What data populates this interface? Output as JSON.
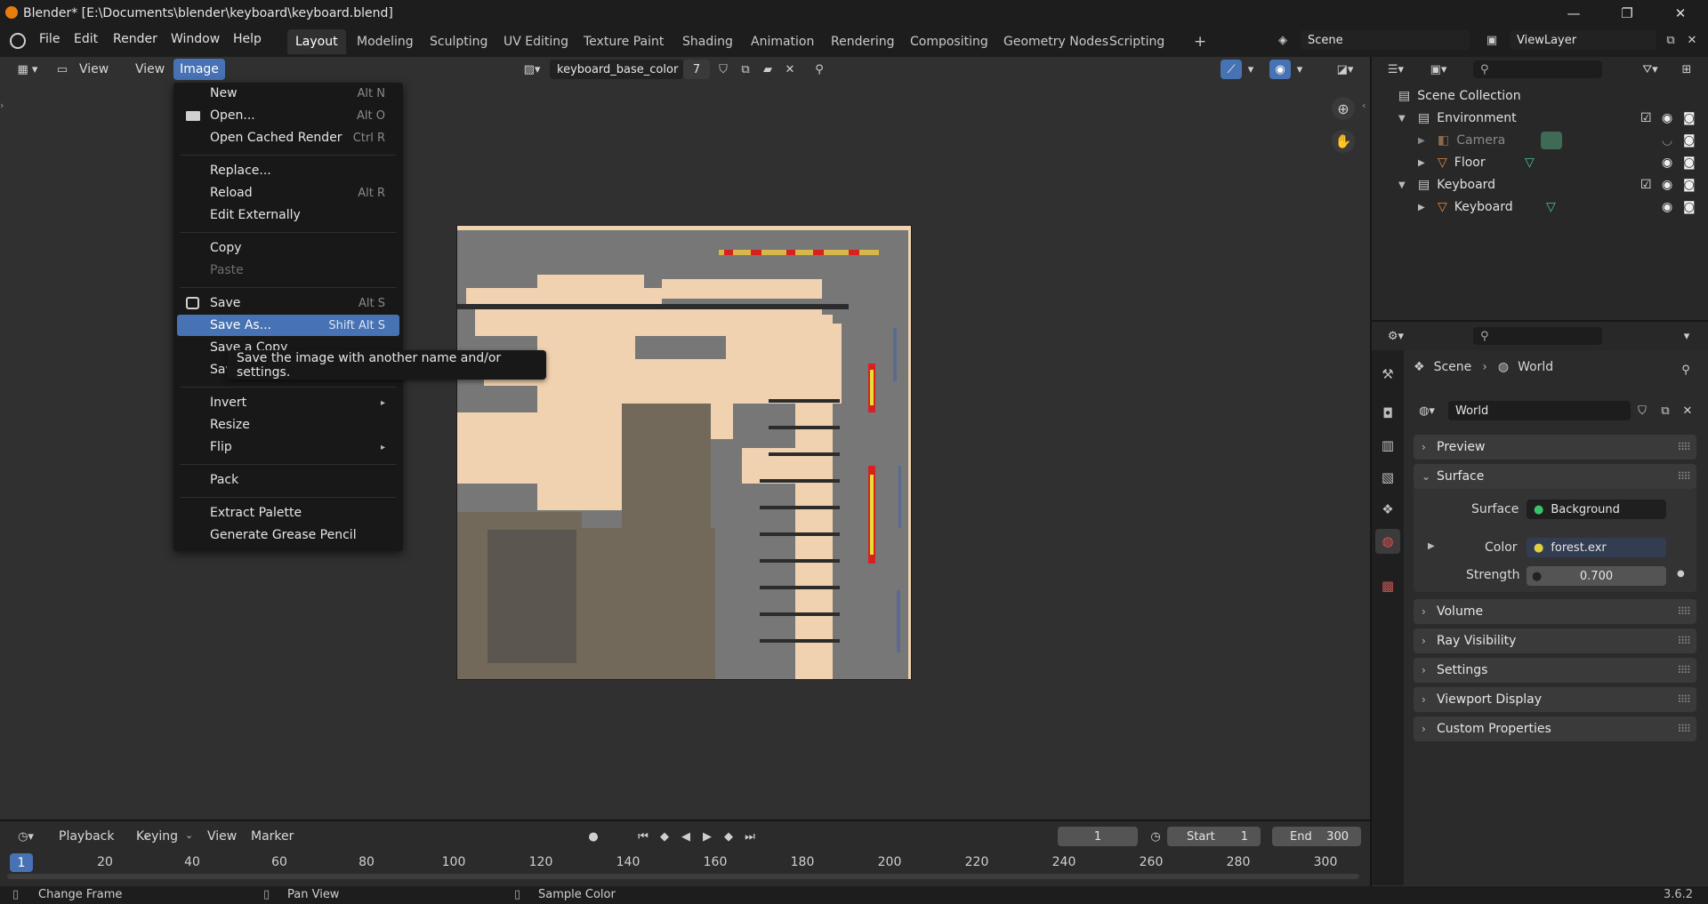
{
  "window": {
    "title": "Blender* [E:\\Documents\\blender\\keyboard\\keyboard.blend]",
    "minimize": "—",
    "maximize": "❐",
    "close": "✕"
  },
  "menubar": {
    "items": [
      "File",
      "Edit",
      "Render",
      "Window",
      "Help"
    ]
  },
  "workspaces": {
    "tabs": [
      "Layout",
      "Modeling",
      "Sculpting",
      "UV Editing",
      "Texture Paint",
      "Shading",
      "Animation",
      "Rendering",
      "Compositing",
      "Geometry Nodes",
      "Scripting"
    ],
    "add": "+"
  },
  "scene": {
    "name": "Scene",
    "view_layer": "ViewLayer"
  },
  "image_editor": {
    "menus": [
      "View",
      "View",
      "Image"
    ],
    "image_name": "keyboard_base_color",
    "users": "7"
  },
  "image_menu": {
    "items": [
      {
        "label": "New",
        "shortcut": "Alt N"
      },
      {
        "label": "Open...",
        "shortcut": "Alt O"
      },
      {
        "label": "Open Cached Render",
        "shortcut": "Ctrl R"
      },
      {
        "label": "Replace...",
        "shortcut": ""
      },
      {
        "label": "Reload",
        "shortcut": "Alt R"
      },
      {
        "label": "Edit Externally",
        "shortcut": ""
      },
      {
        "label": "Copy",
        "shortcut": ""
      },
      {
        "label": "Paste",
        "shortcut": ""
      },
      {
        "label": "Save",
        "shortcut": "Alt S"
      },
      {
        "label": "Save As...",
        "shortcut": "Shift Alt S"
      },
      {
        "label": "Save a Copy",
        "shortcut": ""
      },
      {
        "label": "Save All Images",
        "shortcut": ""
      },
      {
        "label": "Invert",
        "shortcut": ""
      },
      {
        "label": "Resize",
        "shortcut": ""
      },
      {
        "label": "Flip",
        "shortcut": ""
      },
      {
        "label": "Pack",
        "shortcut": ""
      },
      {
        "label": "Extract Palette",
        "shortcut": ""
      },
      {
        "label": "Generate Grease Pencil",
        "shortcut": ""
      }
    ],
    "submenu_arrow": "▸"
  },
  "tooltip": {
    "text": "Save the image with another name and/or settings."
  },
  "outliner": {
    "rows": [
      {
        "label": "Scene Collection"
      },
      {
        "label": "Environment"
      },
      {
        "label": "Camera"
      },
      {
        "label": "Floor"
      },
      {
        "label": "Keyboard"
      },
      {
        "label": "Keyboard"
      }
    ]
  },
  "properties": {
    "breadcrumb": {
      "scene": "Scene",
      "world": "World"
    },
    "world_name": "World",
    "panels": {
      "preview": "Preview",
      "surface": "Surface",
      "volume": "Volume",
      "ray_visibility": "Ray Visibility",
      "settings": "Settings",
      "viewport_display": "Viewport Display",
      "custom_properties": "Custom Properties"
    },
    "surface": {
      "surface_label": "Surface",
      "surface_value": "Background",
      "color_label": "Color",
      "color_value": "forest.exr",
      "strength_label": "Strength",
      "strength_value": "0.700"
    }
  },
  "timeline": {
    "menus": [
      "Playback",
      "Keying",
      "View",
      "Marker"
    ],
    "current_frame": "1",
    "start_label": "Start",
    "start": "1",
    "end_label": "End",
    "end": "300",
    "ruler": [
      "1",
      "20",
      "40",
      "60",
      "80",
      "100",
      "120",
      "140",
      "160",
      "180",
      "200",
      "220",
      "240",
      "260",
      "280",
      "300"
    ]
  },
  "statusbar": {
    "items": [
      "Change Frame",
      "Pan View",
      "Sample Color"
    ],
    "version": "3.6.2"
  },
  "colors": {
    "accent": "#4772b3",
    "background": "#303030",
    "header": "#1d1d1d",
    "texture_beige": "#f0d2b0",
    "texture_gray": "#777777",
    "texture_brown": "#72695a"
  },
  "icons": [
    "blender-logo-icon",
    "search-icon",
    "filter-icon",
    "eye-icon",
    "camera-icon",
    "checkbox-icon",
    "zoom-icon",
    "hand-pan-icon",
    "pin-icon",
    "world-icon",
    "scene-icon"
  ]
}
